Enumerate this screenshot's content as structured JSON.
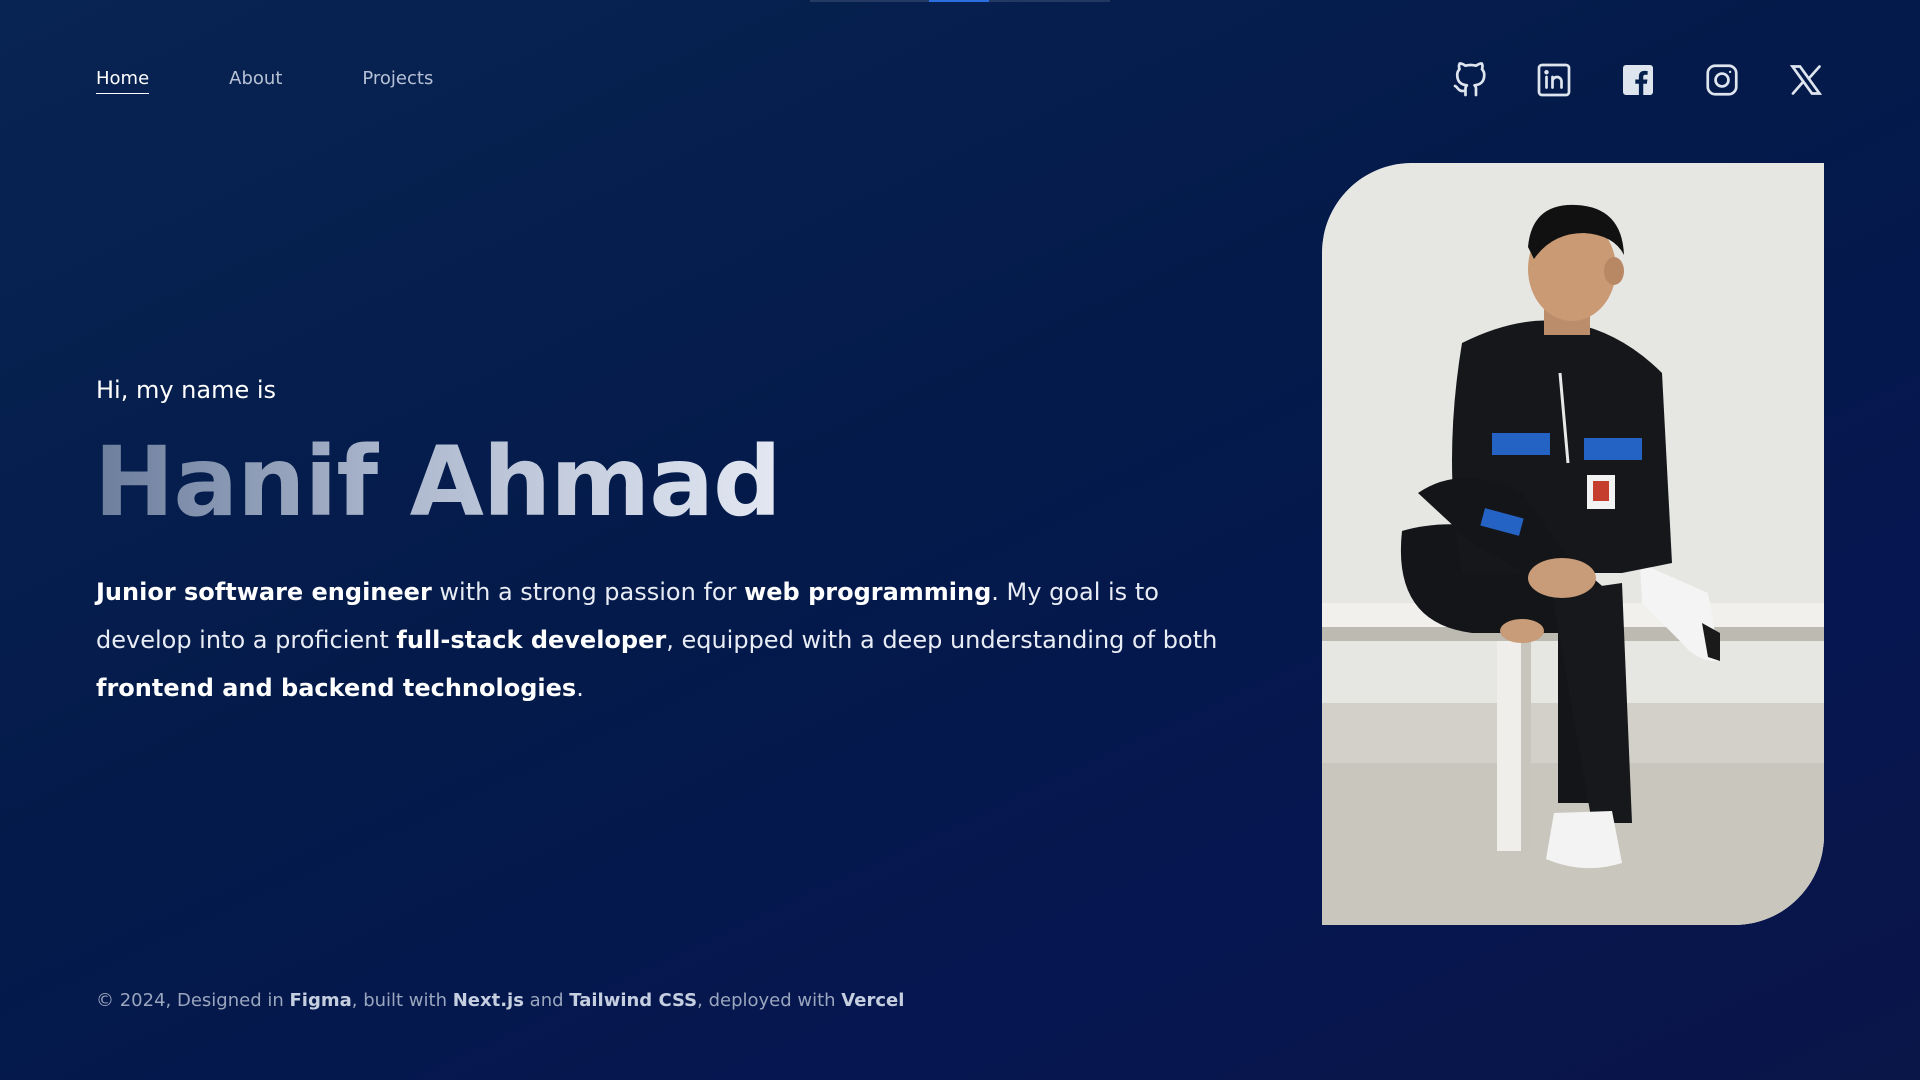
{
  "nav": {
    "items": [
      {
        "label": "Home",
        "active": true
      },
      {
        "label": "About",
        "active": false
      },
      {
        "label": "Projects",
        "active": false
      }
    ]
  },
  "socials": [
    {
      "icon": "github-icon"
    },
    {
      "icon": "linkedin-icon"
    },
    {
      "icon": "facebook-icon"
    },
    {
      "icon": "instagram-icon"
    },
    {
      "icon": "x-twitter-icon"
    }
  ],
  "hero": {
    "intro": "Hi, my name is",
    "name": "Hanif Ahmad",
    "bio": {
      "p1_bold": "Junior software engineer",
      "p2": " with a strong passion for ",
      "p3_bold": "web programming",
      "p4": ". My goal is to develop into a proficient ",
      "p5_bold": "full-stack developer",
      "p6": ", equipped with a deep understanding of both ",
      "p7_bold": "frontend and backend technologies",
      "p8": "."
    }
  },
  "footer": {
    "f1": "© 2024, Designed in ",
    "f2_bold": "Figma",
    "f3": ", built with ",
    "f4_bold": "Next.js",
    "f5": " and ",
    "f6_bold": "Tailwind CSS",
    "f7": ", deployed with ",
    "f8_bold": "Vercel"
  },
  "colors": {
    "background": "#041a4a",
    "accent": "#2a6fe0",
    "text": "#ffffff"
  }
}
